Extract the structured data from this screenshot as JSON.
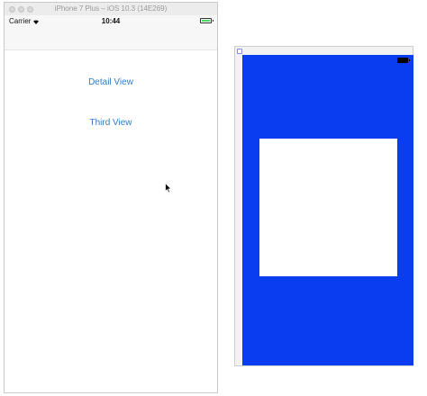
{
  "simulator": {
    "title": "iPhone 7 Plus – iOS 10.3 (14E269)",
    "status_bar": {
      "carrier": "Carrier",
      "time": "10:44",
      "battery_level": 1.0,
      "battery_color": "#4cd964"
    }
  },
  "buttons": {
    "detail_view": "Detail View",
    "third_view": "Third View"
  },
  "colors": {
    "link": "#2f7ec8",
    "blue_screen": "#0a3df0"
  },
  "icons": [
    "wifi-icon",
    "battery-icon",
    "cursor-icon",
    "window-handle-icon"
  ]
}
